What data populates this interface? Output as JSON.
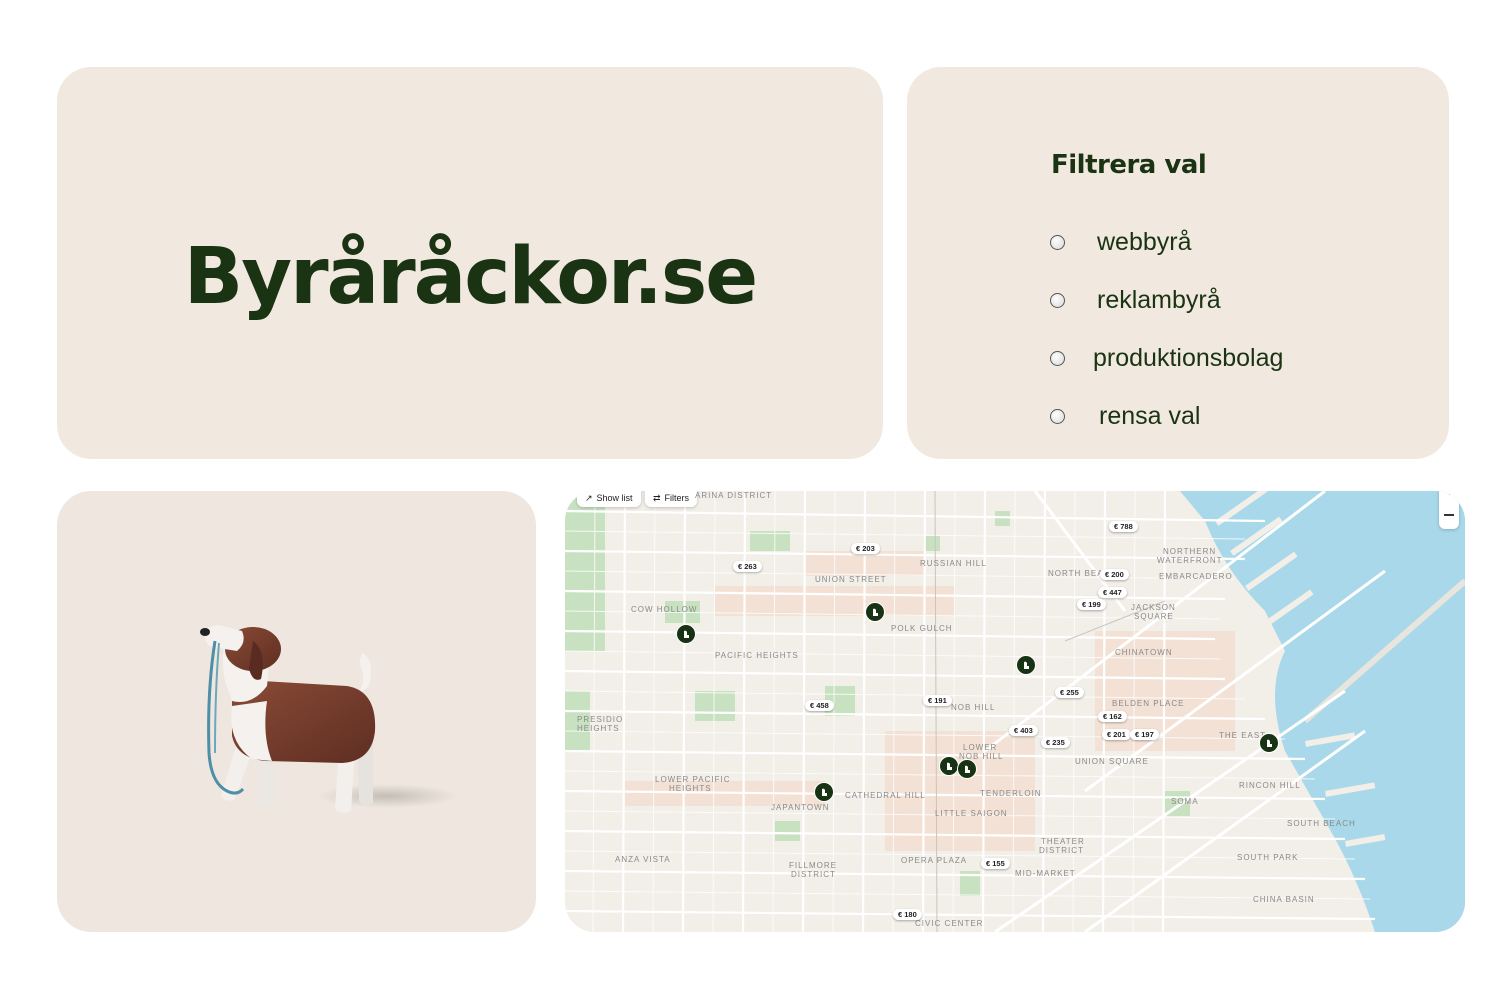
{
  "logo": {
    "text": "Byråracko r.se"
  },
  "filter": {
    "title": "Filtrera val",
    "options": [
      {
        "label": "webbyrå"
      },
      {
        "label": "reklambyrå"
      },
      {
        "label": "produktionsbolag"
      },
      {
        "label": "rensa val"
      }
    ]
  },
  "map": {
    "buttons": {
      "show_list": "Show list",
      "filters": "Filters"
    },
    "areas": [
      "ARINA DISTRICT",
      "RUSSIAN HILL",
      "UNION STREET",
      "NORTH BEAC",
      "NORTHERN",
      "WATERFRONT",
      "EMBARCADERO",
      "COW HOLLOW",
      "POLK GULCH",
      "JACKSON",
      "SQUARE",
      "PACIFIC HEIGHTS",
      "CHINATOWN",
      "BELDEN PLACE",
      "NOB HILL",
      "PRESIDIO",
      "HEIGHTS",
      "LOWER",
      "NOB HILL",
      "THE EAST",
      "UNION SQUARE",
      "LOWER PACIFIC",
      "HEIGHTS",
      "JAPANTOWN",
      "CATHEDRAL HILL",
      "TENDERLOIN",
      "LITTLE SAIGON",
      "RINCON HILL",
      "SOMA",
      "SOUTH BEACH",
      "THEATER",
      "DISTRICT",
      "ANZA VISTA",
      "OPERA PLAZA",
      "FILLMORE",
      "DISTRICT",
      "MID-MARKET",
      "SOUTH PARK",
      "CHINA BASIN",
      "CIVIC CENTER"
    ],
    "prices": [
      "€ 788",
      "€ 203",
      "€ 263",
      "€ 200",
      "€ 447",
      "€ 199",
      "€ 255",
      "€ 191",
      "€ 458",
      "€ 162",
      "€ 403",
      "€ 235",
      "€ 201",
      "€ 197",
      "€ 155",
      "€ 180"
    ],
    "colors": {
      "pin": "#173313",
      "water": "#a8d8ea",
      "park": "#c8e2c1"
    }
  }
}
